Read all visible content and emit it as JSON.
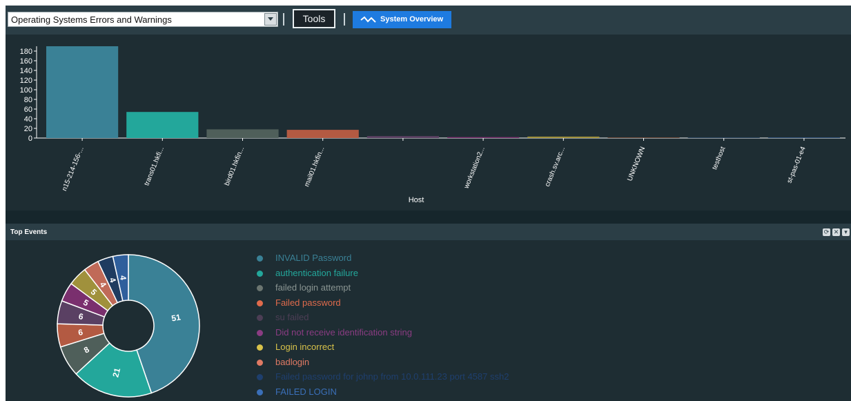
{
  "toolbar": {
    "report_select": "Operating Systems Errors and Warnings",
    "tools_label": "Tools",
    "overview_label": "System Overview"
  },
  "chart_data": [
    {
      "type": "bar",
      "xlabel": "Host",
      "ylabel": "",
      "ylim": [
        0,
        190
      ],
      "y_ticks": [
        0,
        20,
        40,
        60,
        80,
        100,
        120,
        140,
        160,
        180
      ],
      "grid": false,
      "categories": [
        "n15-214-156-...",
        "trans01.hkfi...",
        "bird01.hkfin...",
        "mail01.hkfin...",
        "",
        "workstation2...",
        "crash.sv.arc...",
        "UNKNOWN",
        "testhost",
        "st-pas-01-e4"
      ],
      "values": [
        190,
        54,
        18,
        17,
        4,
        2,
        3,
        1,
        0,
        0
      ],
      "colors": [
        "#3a8196",
        "#23a79b",
        "#4f5f5a",
        "#b35a42",
        "#5a4063",
        "#7a2f6e",
        "#a0913c",
        "#6e4a3a",
        "#2a4460",
        "#2e4f7a"
      ]
    },
    {
      "type": "pie",
      "title": "Top Events",
      "donut": true,
      "start_angle_deg": 0,
      "series": [
        {
          "name": "INVALID Password",
          "value": 51,
          "color": "#3a8196"
        },
        {
          "name": "authentication failure",
          "value": 21,
          "color": "#23a79b"
        },
        {
          "name": "failed login attempt",
          "value": 8,
          "color": "#4f5f5a"
        },
        {
          "name": "Failed password",
          "value": 6,
          "color": "#b35a42"
        },
        {
          "name": "su failed",
          "value": 6,
          "color": "#5a4063"
        },
        {
          "name": "Did not receive identification string",
          "value": 5,
          "color": "#7a2f6e"
        },
        {
          "name": "Login incorrect",
          "value": 5,
          "color": "#a0913c"
        },
        {
          "name": "badlogin",
          "value": 4,
          "color": "#c06a58"
        },
        {
          "name": "Failed password for johnp from 10.0.111.23 port 4587 ssh2",
          "value": 4,
          "color": "#1f3c60"
        },
        {
          "name": "FAILED LOGIN",
          "value": 4,
          "color": "#2f5f9c"
        }
      ]
    }
  ],
  "legend_colors": [
    "#3a8196",
    "#23a79b",
    "#6b7570",
    "#e06b4c",
    "#4c3e55",
    "#8a3c82",
    "#d8c24a",
    "#e07a64",
    "#1e3f6e",
    "#3a6fb8"
  ],
  "legend_text_colors": [
    "#3a8196",
    "#23a79b",
    "#8a9592",
    "#e06b4c",
    "#4c3e55",
    "#8a3c82",
    "#d8c24a",
    "#e07a64",
    "#1e3f6e",
    "#3a6fb8"
  ]
}
